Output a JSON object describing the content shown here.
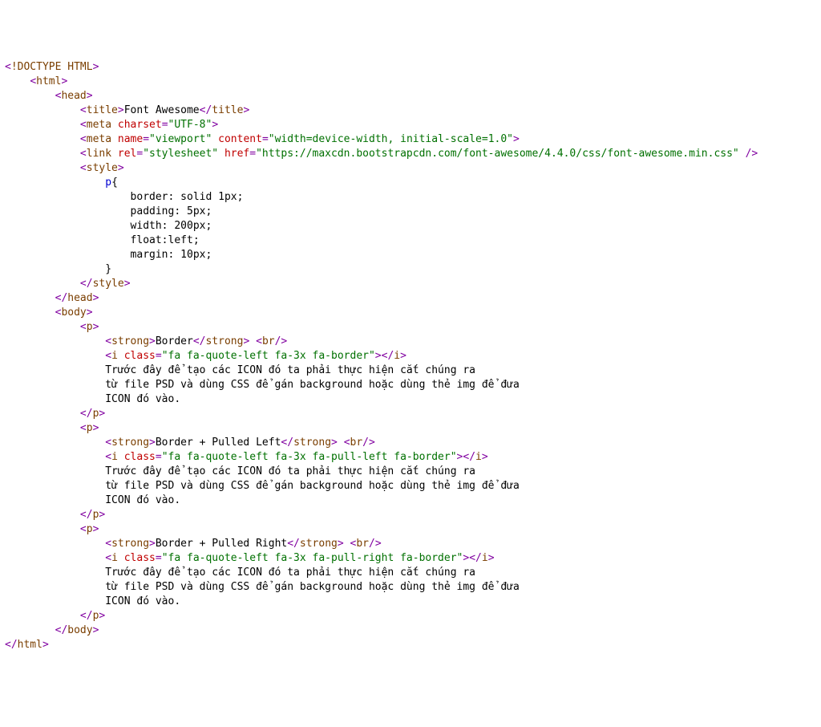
{
  "tok": {
    "lt": "<",
    "gt": ">",
    "lts": "</",
    "sgt": "/>",
    "eq": "=",
    "ob": "{",
    "cb": "}",
    "doctype": "!DOCTYPE HTML",
    "html": "html",
    "head": "head",
    "title": "title",
    "meta": "meta",
    "link": "link",
    "style": "style",
    "body": "body",
    "p": "p",
    "strong": "strong",
    "br": "br",
    "i": "i",
    "a_charset": "charset",
    "a_name": "name",
    "a_content": "content",
    "a_rel": "rel",
    "a_href": "href",
    "a_class": "class"
  },
  "txt": {
    "title": "Font Awesome",
    "charset": "\"UTF-8\"",
    "viewport": "\"viewport\"",
    "viewcontent": "\"width=device-width, initial-scale=1.0\"",
    "relval": "\"stylesheet\"",
    "hrefval": "\"https://maxcdn.bootstrapcdn.com/font-awesome/4.4.0/css/font-awesome.min.css\"",
    "css_sel": "p",
    "css_border": "border: solid 1px;",
    "css_padding": "padding: 5px;",
    "css_width": "width: 200px;",
    "css_float": "float:left;",
    "css_margin": "margin: 10px;",
    "label1": "Border",
    "label2": "Border + Pulled Left",
    "label3": "Border + Pulled Right",
    "cls1": "\"fa fa-quote-left fa-3x fa-border\"",
    "cls2": "\"fa fa-quote-left fa-3x fa-pull-left fa-border\"",
    "cls3": "\"fa fa-quote-left fa-3x fa-pull-right fa-border\"",
    "para1": "Trước đây để tạo các ICON đó ta phải thực hiện cắt chúng ra",
    "para2": "từ file PSD và dùng CSS để gán background hoặc dùng thẻ img để đưa",
    "para3": "ICON đó vào."
  }
}
